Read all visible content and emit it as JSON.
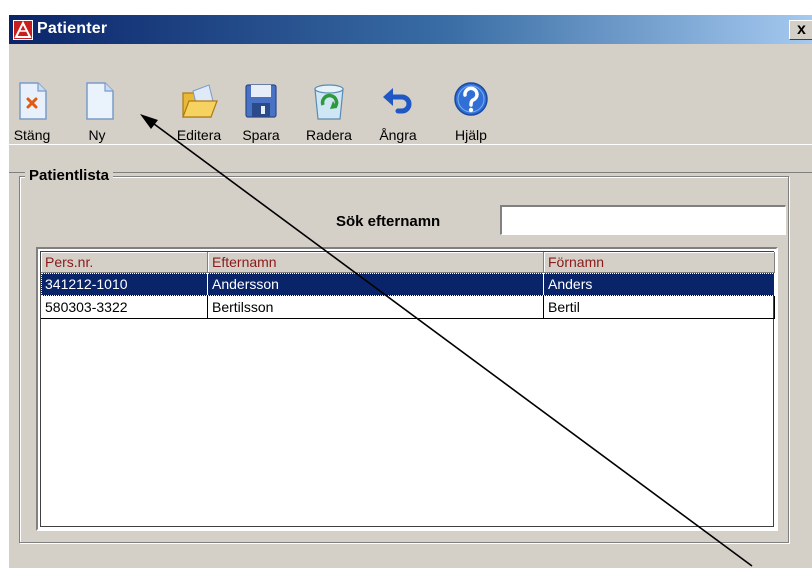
{
  "window": {
    "title": "Patienter",
    "close_glyph": "x"
  },
  "toolbar": {
    "buttons": [
      {
        "label": "Stäng",
        "icon": "close-document-icon"
      },
      {
        "label": "Ny",
        "icon": "new-document-icon"
      },
      {
        "label": "Editera",
        "icon": "open-folder-icon"
      },
      {
        "label": "Spara",
        "icon": "floppy-disk-icon"
      },
      {
        "label": "Radera",
        "icon": "recycle-bin-icon"
      },
      {
        "label": "Ångra",
        "icon": "undo-arrow-icon"
      },
      {
        "label": "Hjälp",
        "icon": "help-question-icon"
      }
    ]
  },
  "patient_list": {
    "group_title": "Patientlista",
    "search_label": "Sök efternamn",
    "search_value": "",
    "columns": [
      "Pers.nr.",
      "Efternamn",
      "Förnamn"
    ],
    "rows": [
      {
        "pnr": "341212-1010",
        "efternamn": "Andersson",
        "fornamn": "Anders",
        "selected": true
      },
      {
        "pnr": "580303-3322",
        "efternamn": "Bertilsson",
        "fornamn": "Bertil",
        "selected": false
      }
    ]
  },
  "colors": {
    "title_gradient_start": "#0a246a",
    "selection": "#0a246a",
    "header_text": "#8b1a1a",
    "face": "#d4d0c8"
  }
}
